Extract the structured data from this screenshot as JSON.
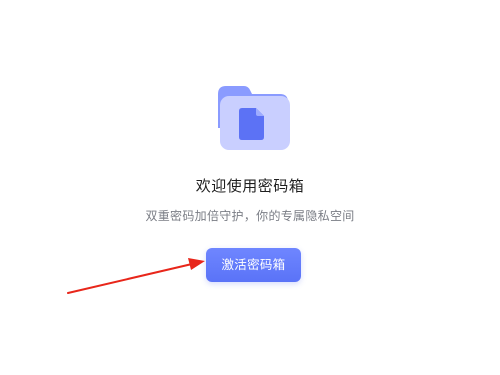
{
  "illustration": {
    "icon": "folder-document-icon",
    "colors": {
      "folder_back": "#8a9bff",
      "folder_front": "#c7cdff",
      "document": "#5c72f5"
    }
  },
  "welcome": {
    "title": "欢迎使用密码箱",
    "subtitle": "双重密码加倍守护，你的专属隐私空间"
  },
  "actions": {
    "activate_label": "激活密码箱",
    "accent_color": "#5f78fa"
  },
  "annotation": {
    "icon": "red-arrow-icon",
    "color": "#e8261a"
  }
}
